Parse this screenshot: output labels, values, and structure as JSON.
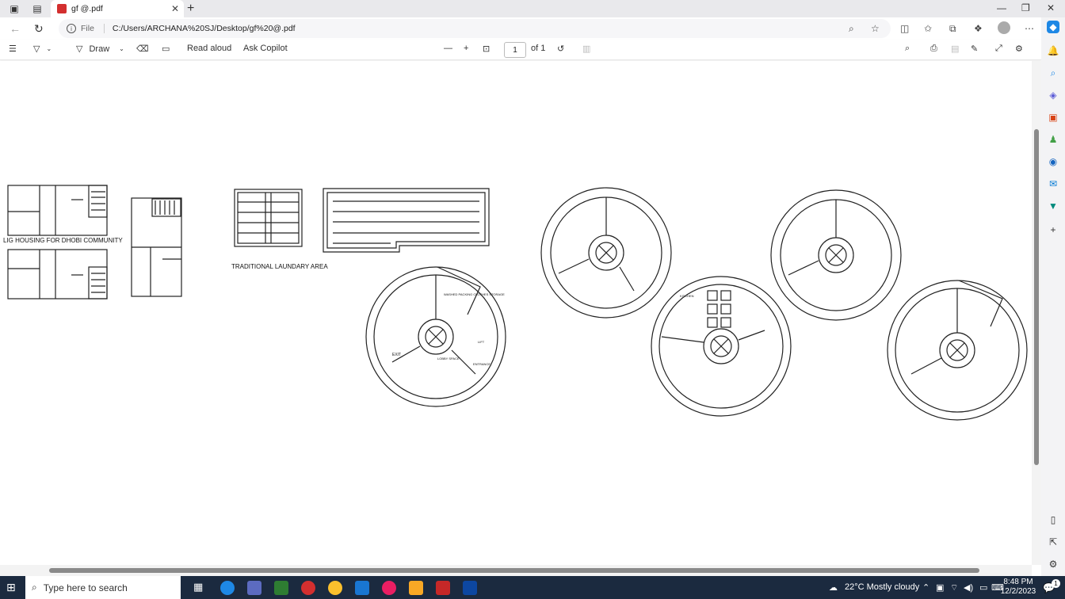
{
  "browser": {
    "tab_title": "gf @.pdf",
    "address_prefix": "File",
    "url": "C:/Users/ARCHANA%20SJ/Desktop/gf%20@.pdf"
  },
  "pdf_toolbar": {
    "draw_label": "Draw",
    "read_aloud_label": "Read aloud",
    "ask_copilot_label": "Ask Copilot",
    "page_number": "1",
    "page_total": "of 1"
  },
  "document": {
    "labels": {
      "lig_housing": "LIG HOUSING FOR DHOBI COMMUNITY",
      "laundry_area": "TRADITIONAL LAUNDARY AREA"
    },
    "plan_text": {
      "exit": "EXIT",
      "lobby": "LOBBY SPACE",
      "lift": "LIFT",
      "kitchen": "KITCHEN",
      "entrance": "ENTRANCE",
      "washed_packing": "WASHED PACKING CLOTHES STORAGE"
    }
  },
  "taskbar": {
    "search_placeholder": "Type here to search",
    "weather": "22°C  Mostly cloudy",
    "time": "8:48 PM",
    "date": "12/2/2023",
    "notification_count": "1"
  }
}
